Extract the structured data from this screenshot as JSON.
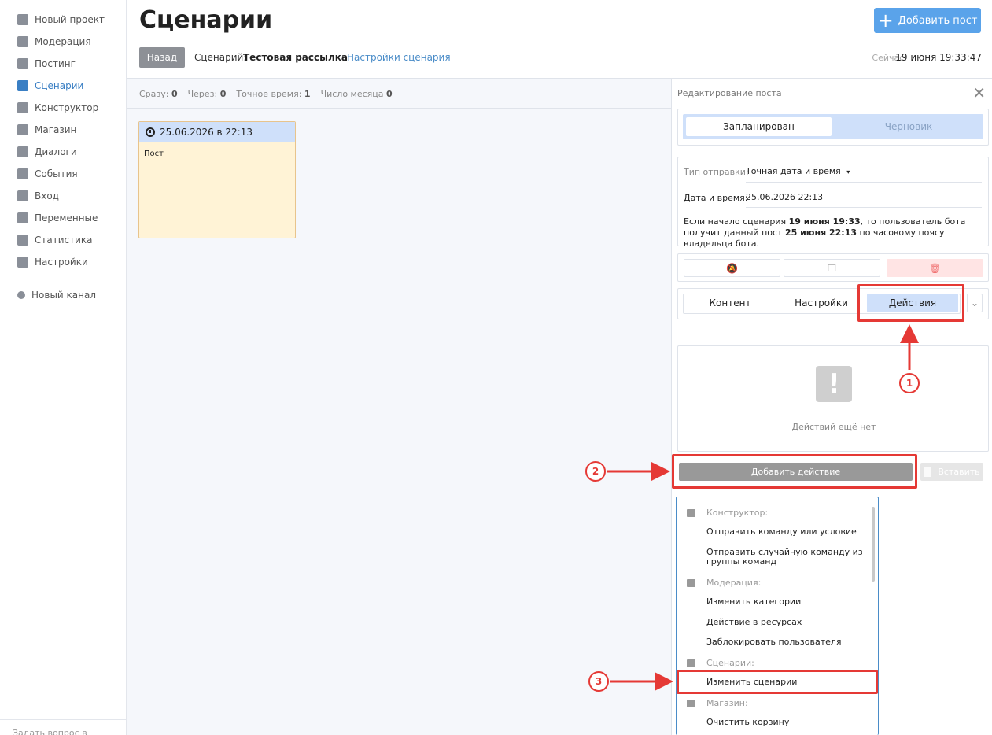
{
  "sidebar": {
    "items": [
      {
        "label": "Новый проект",
        "icon": "basket-icon"
      },
      {
        "label": "Модерация",
        "icon": "users-icon"
      },
      {
        "label": "Постинг",
        "icon": "send-icon"
      },
      {
        "label": "Сценарии",
        "icon": "scenario-icon",
        "active": true
      },
      {
        "label": "Конструктор",
        "icon": "grid-icon"
      },
      {
        "label": "Магазин",
        "icon": "cart-icon"
      },
      {
        "label": "Диалоги",
        "icon": "chat-icon"
      },
      {
        "label": "События",
        "icon": "star-icon"
      },
      {
        "label": "Вход",
        "icon": "login-icon"
      },
      {
        "label": "Переменные",
        "icon": "variable-icon"
      },
      {
        "label": "Статистика",
        "icon": "pie-chart-icon"
      },
      {
        "label": "Настройки",
        "icon": "gear-icon"
      }
    ],
    "channel": {
      "label": "Новый канал",
      "icon": "channel-icon"
    },
    "footer": "Задать вопрос в"
  },
  "header": {
    "title": "Сценарии",
    "add_post": "Добавить пост",
    "back": "Назад",
    "scenario_label": "Сценарий:",
    "scenario_name": "Тестовая рассылка",
    "scenario_settings": "Настройки сценария",
    "now_label": "Сейчас:",
    "now_value": "19 июня 19:33:47"
  },
  "stats": {
    "immediately_label": "Сразу:",
    "immediately": "0",
    "after_label": "Через:",
    "after": "0",
    "exact_label": "Точное время:",
    "exact": "1",
    "day_label": "Число месяца",
    "day": "0"
  },
  "post_card": {
    "datetime": "25.06.2026 в 22:13",
    "text": "Пост"
  },
  "editor": {
    "title": "Редактирование поста",
    "status_planned": "Запланирован",
    "status_draft": "Черновик",
    "send_type_label": "Тип отправки:",
    "send_type_value": "Точная дата и время",
    "datetime_label": "Дата и время:",
    "datetime_value": "25.06.2026 22:13",
    "note_1": "Если начало сценария ",
    "note_b1": "19 июня 19:33",
    "note_2": ", то пользователь бота получит данный пост ",
    "note_b2": "25 июня 22:13",
    "note_3": " по часовому поясу владельца бота.",
    "tabs": [
      "Контент",
      "Настройки",
      "Действия"
    ],
    "empty_actions": "Действий ещё нет",
    "add_action": "Добавить действие",
    "paste": "Вставить"
  },
  "dropdown": {
    "groups": [
      {
        "label": "Конструктор:",
        "items": [
          "Отправить команду или условие",
          "Отправить случайную команду из группы команд"
        ]
      },
      {
        "label": "Модерация:",
        "items": [
          "Изменить категории",
          "Действие в ресурсах",
          "Заблокировать пользователя"
        ]
      },
      {
        "label": "Сценарии:",
        "items": [
          "Изменить сценарии"
        ]
      },
      {
        "label": "Магазин:",
        "items": [
          "Очистить корзину"
        ]
      }
    ]
  },
  "callouts": [
    "1",
    "2",
    "3"
  ],
  "colors": {
    "accent": "#5aa3ea",
    "link": "#4a8cc8",
    "highlight": "#e53935",
    "tab_active": "#cfe0fa",
    "card": "#fff3d6"
  }
}
